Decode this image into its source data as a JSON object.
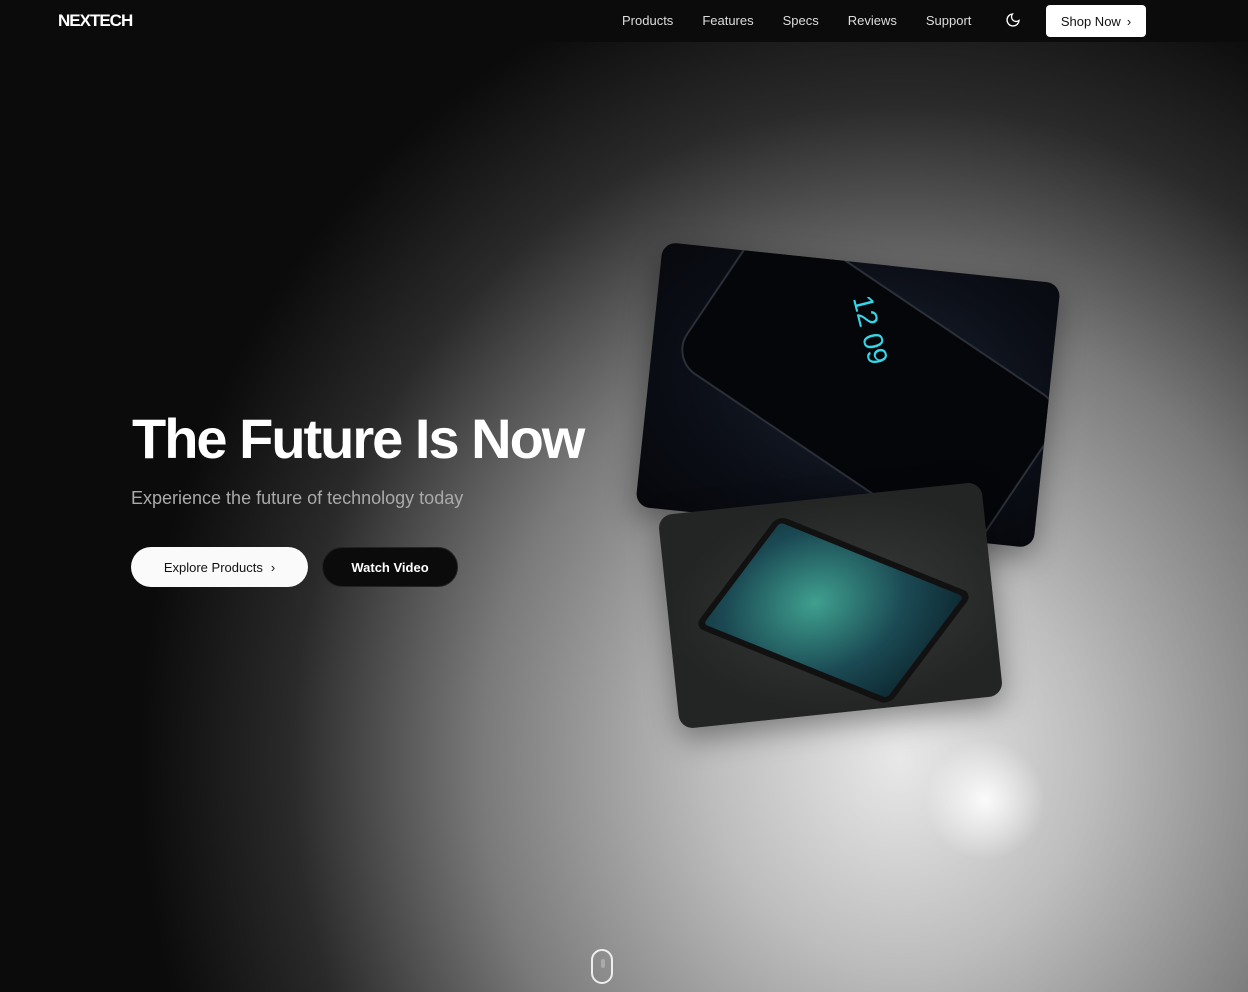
{
  "nav": {
    "logo": "NEXTECH",
    "links": [
      "Products",
      "Features",
      "Specs",
      "Reviews",
      "Support"
    ],
    "shop_label": "Shop Now"
  },
  "hero": {
    "title": "The Future Is Now",
    "subtitle": "Experience the future of technology today",
    "explore_label": "Explore Products",
    "watch_label": "Watch Video"
  },
  "images": {
    "phone_clock": "12 09"
  }
}
